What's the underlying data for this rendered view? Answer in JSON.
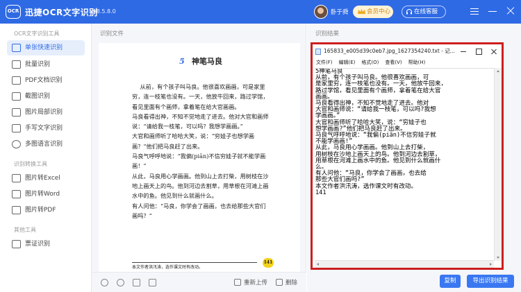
{
  "app": {
    "logo_text": "OCR",
    "title": "迅捷OCR文字识别",
    "version": "v8.5.8.0",
    "username": "卧于舜",
    "member_label": "会员中心",
    "service_label": "在线客服"
  },
  "sidebar": {
    "sections": [
      {
        "title": "OCR文字识别工具",
        "items": [
          {
            "label": "单张快速识别",
            "active": true
          },
          {
            "label": "批量识别",
            "active": false
          },
          {
            "label": "PDF文档识别",
            "active": false
          },
          {
            "label": "截图识别",
            "active": false
          },
          {
            "label": "图片局部识别",
            "active": false
          },
          {
            "label": "手写文字识别",
            "active": false
          },
          {
            "label": "多图语言识别",
            "active": false
          }
        ]
      },
      {
        "title": "识别转换工具",
        "items": [
          {
            "label": "图片转Excel",
            "active": false
          },
          {
            "label": "图片转Word",
            "active": false
          },
          {
            "label": "图片转PDF",
            "active": false
          }
        ]
      },
      {
        "title": "其他工具",
        "items": [
          {
            "label": "票证识别",
            "active": false
          }
        ]
      }
    ]
  },
  "left_panel": {
    "label": "识别文件",
    "reupload_label": "重新上传",
    "delete_label": "删除"
  },
  "document": {
    "number": "5",
    "title": "神笔马良",
    "body": "从前，有个孩子叫马良。他很喜欢画画，可是家里穷，连一枝笔也没有。一天，他放牛回来，路过学馆，看见里面有个画师，拿着笔在给大官画画。\n马良看得出神，不知不觉地走了进去。他对大官和画师说：“请给我一枝笔，可以吗？我想学画画。”\n大官和画师听了哈哈大笑，说：“穷娃子也想学画画？”他们把马良赶了出来。\n马良气呼呼地说：“我偏(piān)不信穷娃子就不能学画画！”\n从此，马良用心学画画。他到山上去打柴，用树枝在沙地上画天上的鸟。他到河边去割草，用草根在河滩上画水中的鱼。他见到什么就画什么。\n有人问他：“马良，你学会了画画，也去给那些大官们画吗？”",
    "note": "本文作者洪汛涛，选作课文时有改动。",
    "page": "141"
  },
  "right_panel": {
    "label": "识别结果",
    "copy_label": "复制",
    "export_label": "导出识别结果"
  },
  "notepad": {
    "title": "165833_e005d39c0eb7.jpg_1627354240.txt - 记...",
    "menus": [
      "文件(F)",
      "编辑(E)",
      "格式(O)",
      "查看(V)",
      "帮助(H)"
    ],
    "content": "5神笔马良\n从前，有个孩子叫马良。他很喜欢画画，可\n是家里穷，连一枝笔也没有。一天，他放牛回来，\n路过学馆，看见里面有个画师，拿着笔在给大官\n画画。\n马良看得出神，不知不觉地走了进去。他对\n大官和画师说：“请给我一枝笔，可以吗?我想\n学画画。”\n大官和画师听了哈哈大笑，说：“穷娃子也\n想学画画?”他们把马良赶了出来。\n马良气呼呼地说：“我偏(piān)不信穷娃子就\n不能学画画!”\n从此，马良用心学画画。他到山上去打柴，\n用树枝在沙地上画天上的鸟。他到河边去割草，\n用草根在河滩上画水中的鱼。他见到什么就画什\n么。\n有人问他：“马良，你学会了画画，也去给\n那些大官们画吗?”\n本文作者洪汛涛，选作课文时有改动。\n141"
  },
  "colors": {
    "brand": "#2f6ae5",
    "highlight_border": "#cc1f1f",
    "button": "#3a78f2"
  },
  "icons": {
    "logo": "ocr-logo-icon",
    "member": "crown-icon",
    "service": "headset-icon",
    "window": [
      "menu-icon",
      "minimize-icon",
      "close-icon"
    ],
    "toolbar": [
      "zoom-in-icon",
      "zoom-out-icon",
      "rotate-icon",
      "fit-icon",
      "crop-icon",
      "refresh-icon",
      "trash-icon"
    ]
  }
}
